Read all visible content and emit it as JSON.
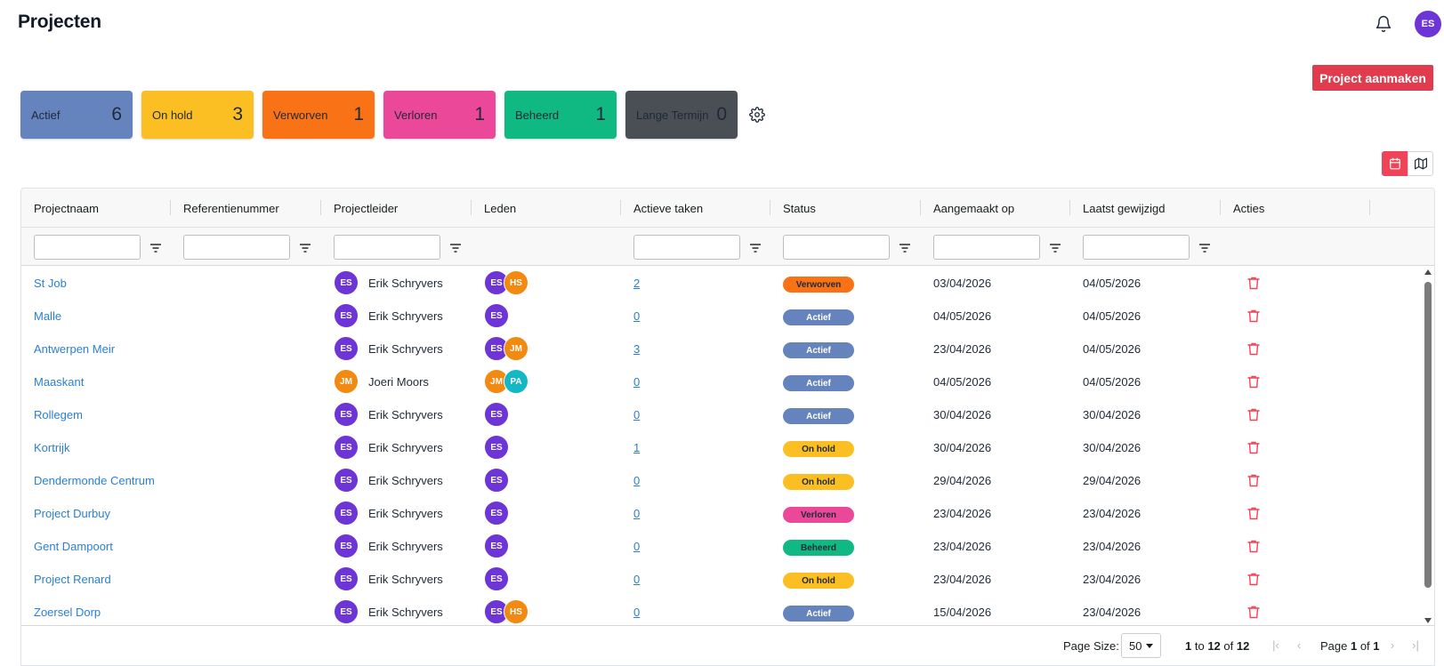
{
  "header": {
    "title": "Projecten",
    "bell_icon": "bell-icon",
    "user_initials": "ES"
  },
  "create_button": "Project aanmaken",
  "status_cards": [
    {
      "label": "Actief",
      "count": "6",
      "color": "#6584bd"
    },
    {
      "label": "On hold",
      "count": "3",
      "color": "#fbbf24"
    },
    {
      "label": "Verworven",
      "count": "1",
      "color": "#f97316"
    },
    {
      "label": "Verloren",
      "count": "1",
      "color": "#ec4899"
    },
    {
      "label": "Beheerd",
      "count": "1",
      "color": "#10b981"
    },
    {
      "label": "Lange Termijn",
      "count": "0",
      "color": "#4a4f55"
    }
  ],
  "columns": [
    "Projectnaam",
    "Referentienummer",
    "Projectleider",
    "Leden",
    "Actieve taken",
    "Status",
    "Aangemaakt op",
    "Laatst gewijzigd",
    "Acties"
  ],
  "rows": [
    {
      "name": "St Job",
      "ref": "",
      "leader_initials": "ES",
      "leader": "Erik Schryvers",
      "members": [
        "ES",
        "HS"
      ],
      "tasks": "2",
      "status": "Verworven",
      "created": "03/04/2026",
      "modified": "04/05/2026"
    },
    {
      "name": "Malle",
      "ref": "",
      "leader_initials": "ES",
      "leader": "Erik Schryvers",
      "members": [
        "ES"
      ],
      "tasks": "0",
      "status": "Actief",
      "created": "04/05/2026",
      "modified": "04/05/2026"
    },
    {
      "name": "Antwerpen Meir",
      "ref": "",
      "leader_initials": "ES",
      "leader": "Erik Schryvers",
      "members": [
        "ES",
        "JM"
      ],
      "tasks": "3",
      "status": "Actief",
      "created": "23/04/2026",
      "modified": "04/05/2026"
    },
    {
      "name": "Maaskant",
      "ref": "",
      "leader_initials": "JM",
      "leader": "Joeri Moors",
      "members": [
        "JM",
        "PA"
      ],
      "tasks": "0",
      "status": "Actief",
      "created": "04/05/2026",
      "modified": "04/05/2026"
    },
    {
      "name": "Rollegem",
      "ref": "",
      "leader_initials": "ES",
      "leader": "Erik Schryvers",
      "members": [
        "ES"
      ],
      "tasks": "0",
      "status": "Actief",
      "created": "30/04/2026",
      "modified": "30/04/2026"
    },
    {
      "name": "Kortrijk",
      "ref": "",
      "leader_initials": "ES",
      "leader": "Erik Schryvers",
      "members": [
        "ES"
      ],
      "tasks": "1",
      "status": "On hold",
      "created": "30/04/2026",
      "modified": "30/04/2026"
    },
    {
      "name": "Dendermonde Centrum",
      "ref": "",
      "leader_initials": "ES",
      "leader": "Erik Schryvers",
      "members": [
        "ES"
      ],
      "tasks": "0",
      "status": "On hold",
      "created": "29/04/2026",
      "modified": "29/04/2026"
    },
    {
      "name": "Project Durbuy",
      "ref": "",
      "leader_initials": "ES",
      "leader": "Erik Schryvers",
      "members": [
        "ES"
      ],
      "tasks": "0",
      "status": "Verloren",
      "created": "23/04/2026",
      "modified": "23/04/2026"
    },
    {
      "name": "Gent Dampoort",
      "ref": "",
      "leader_initials": "ES",
      "leader": "Erik Schryvers",
      "members": [
        "ES"
      ],
      "tasks": "0",
      "status": "Beheerd",
      "created": "23/04/2026",
      "modified": "23/04/2026"
    },
    {
      "name": "Project Renard",
      "ref": "",
      "leader_initials": "ES",
      "leader": "Erik Schryvers",
      "members": [
        "ES"
      ],
      "tasks": "0",
      "status": "On hold",
      "created": "23/04/2026",
      "modified": "23/04/2026"
    },
    {
      "name": "Zoersel Dorp",
      "ref": "",
      "leader_initials": "ES",
      "leader": "Erik Schryvers",
      "members": [
        "ES",
        "HS"
      ],
      "tasks": "0",
      "status": "Actief",
      "created": "15/04/2026",
      "modified": "23/04/2026"
    }
  ],
  "pagination": {
    "page_size_label": "Page Size:",
    "page_size": "50",
    "range_from": "1",
    "range_to": "12",
    "range_total": "12",
    "page_current": "1",
    "page_total": "1"
  }
}
